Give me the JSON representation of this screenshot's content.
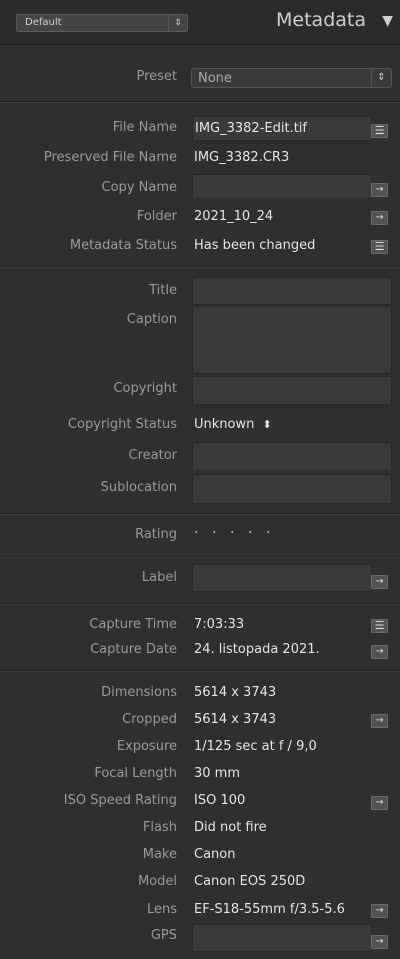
{
  "header": {
    "preset_dropdown": "Default",
    "panel_title": "Metadata",
    "collapse_icon": "triangle-down-icon"
  },
  "preset": {
    "label": "Preset",
    "value": "None"
  },
  "file": {
    "file_name_label": "File Name",
    "file_name": "IMG_3382-Edit.tif",
    "preserved_label": "Preserved File Name",
    "preserved": "IMG_3382.CR3",
    "copy_name_label": "Copy Name",
    "copy_name": "",
    "folder_label": "Folder",
    "folder": "2021_10_24",
    "status_label": "Metadata Status",
    "status": "Has been changed"
  },
  "iptc": {
    "title_label": "Title",
    "caption_label": "Caption",
    "copyright_label": "Copyright",
    "copyright_status_label": "Copyright Status",
    "copyright_status": "Unknown",
    "creator_label": "Creator",
    "sublocation_label": "Sublocation"
  },
  "rating": {
    "label": "Rating",
    "dots": [
      "·",
      "·",
      "·",
      "·",
      "·"
    ],
    "value": 0
  },
  "label": {
    "label": "Label",
    "value": ""
  },
  "capture": {
    "time_label": "Capture Time",
    "time": "7:03:33",
    "date_label": "Capture Date",
    "date": "24. listopada 2021."
  },
  "exif": {
    "dimensions_label": "Dimensions",
    "dimensions": "5614 x 3743",
    "cropped_label": "Cropped",
    "cropped": "5614 x 3743",
    "exposure_label": "Exposure",
    "exposure": "1/125 sec at f / 9,0",
    "focal_label": "Focal Length",
    "focal": "30 mm",
    "iso_label": "ISO Speed Rating",
    "iso": "ISO 100",
    "flash_label": "Flash",
    "flash": "Did not fire",
    "make_label": "Make",
    "make": "Canon",
    "model_label": "Model",
    "model": "Canon EOS 250D",
    "lens_label": "Lens",
    "lens": "EF-S18-55mm f/3.5-5.6",
    "gps_label": "GPS",
    "gps": ""
  },
  "glyphs": {
    "arrow": "→",
    "list": "☰",
    "updown": "⇕",
    "spin": "⬍",
    "tri": "▼"
  }
}
